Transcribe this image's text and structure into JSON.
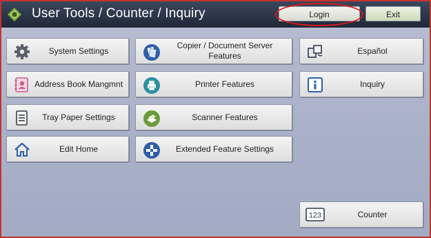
{
  "header": {
    "title": "User Tools / Counter / Inquiry",
    "login_label": "Login",
    "exit_label": "Exit"
  },
  "left_column": [
    {
      "label": "System Settings",
      "icon": "gear-icon"
    },
    {
      "label": "Address Book Mangmnt",
      "icon": "address-book-icon"
    },
    {
      "label": "Tray Paper Settings",
      "icon": "tray-paper-icon"
    },
    {
      "label": "Edit Home",
      "icon": "home-icon"
    }
  ],
  "middle_column": [
    {
      "label": "Copier / Document Server Features",
      "icon": "copier-icon"
    },
    {
      "label": "Printer Features",
      "icon": "printer-icon"
    },
    {
      "label": "Scanner Features",
      "icon": "scanner-icon"
    },
    {
      "label": "Extended Feature Settings",
      "icon": "extended-features-icon"
    }
  ],
  "right_column": [
    {
      "label": "Español",
      "icon": "language-switch-icon"
    },
    {
      "label": "Inquiry",
      "icon": "info-icon"
    }
  ],
  "counter": {
    "label": "Counter",
    "icon": "counter-123-icon",
    "icon_text": "123"
  },
  "colors": {
    "header_bg": "#2b3446",
    "panel_bg": "#b3bacf",
    "highlight_ring": "#e01818",
    "icon_blue": "#2f5fa8",
    "icon_green": "#6d9a3a",
    "icon_pink": "#c9618f"
  }
}
